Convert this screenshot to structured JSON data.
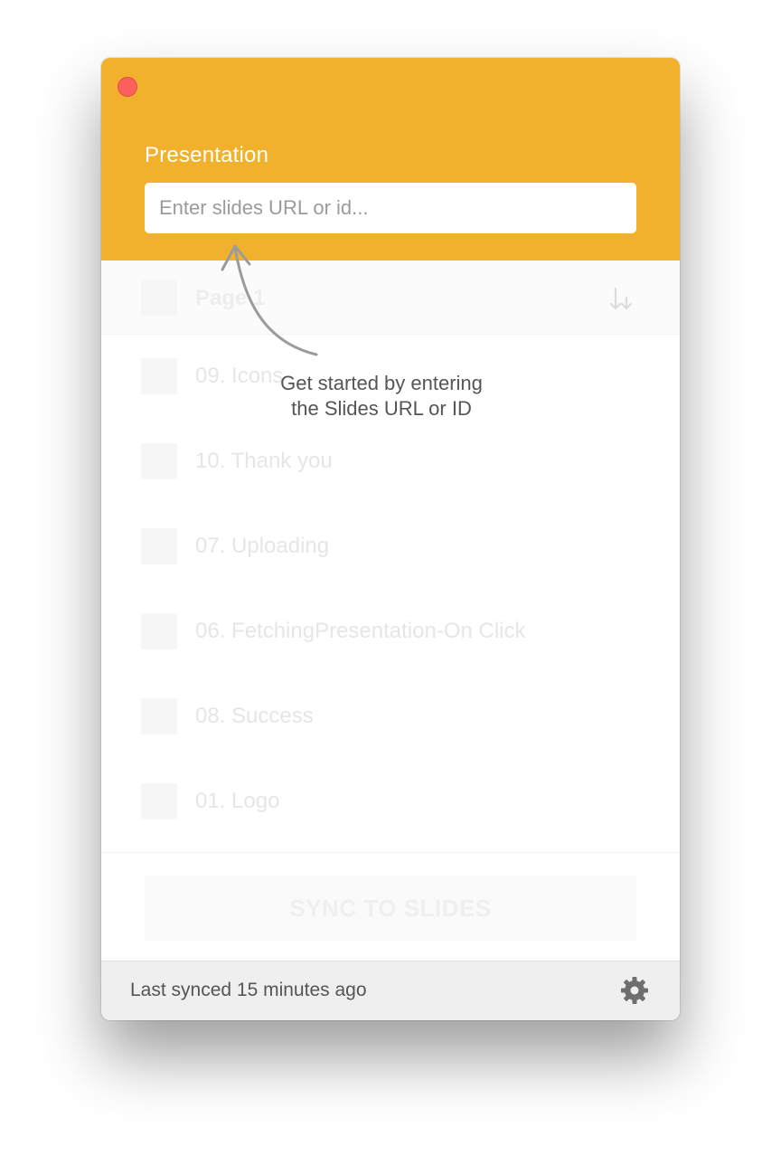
{
  "window": {
    "close_button": "close",
    "close_color": "#FC605C"
  },
  "header": {
    "title": "Presentation",
    "input_placeholder": "Enter slides URL or id...",
    "input_value": "",
    "accent_color": "#F1B12C"
  },
  "page_header": {
    "title": "Page 1",
    "sort_icon": "sort-icon"
  },
  "list": {
    "items": [
      {
        "label": "09. Icons"
      },
      {
        "label": "10. Thank you"
      },
      {
        "label": "07. Uploading"
      },
      {
        "label": "06. FetchingPresentation-On Click"
      },
      {
        "label": "08. Success"
      },
      {
        "label": "01. Logo"
      }
    ]
  },
  "hint": {
    "line1": "Get started by entering",
    "line2": "the Slides URL or ID"
  },
  "sync": {
    "label": "SYNC TO SLIDES"
  },
  "footer": {
    "status": "Last synced 15 minutes ago",
    "settings_icon": "gear-icon"
  }
}
